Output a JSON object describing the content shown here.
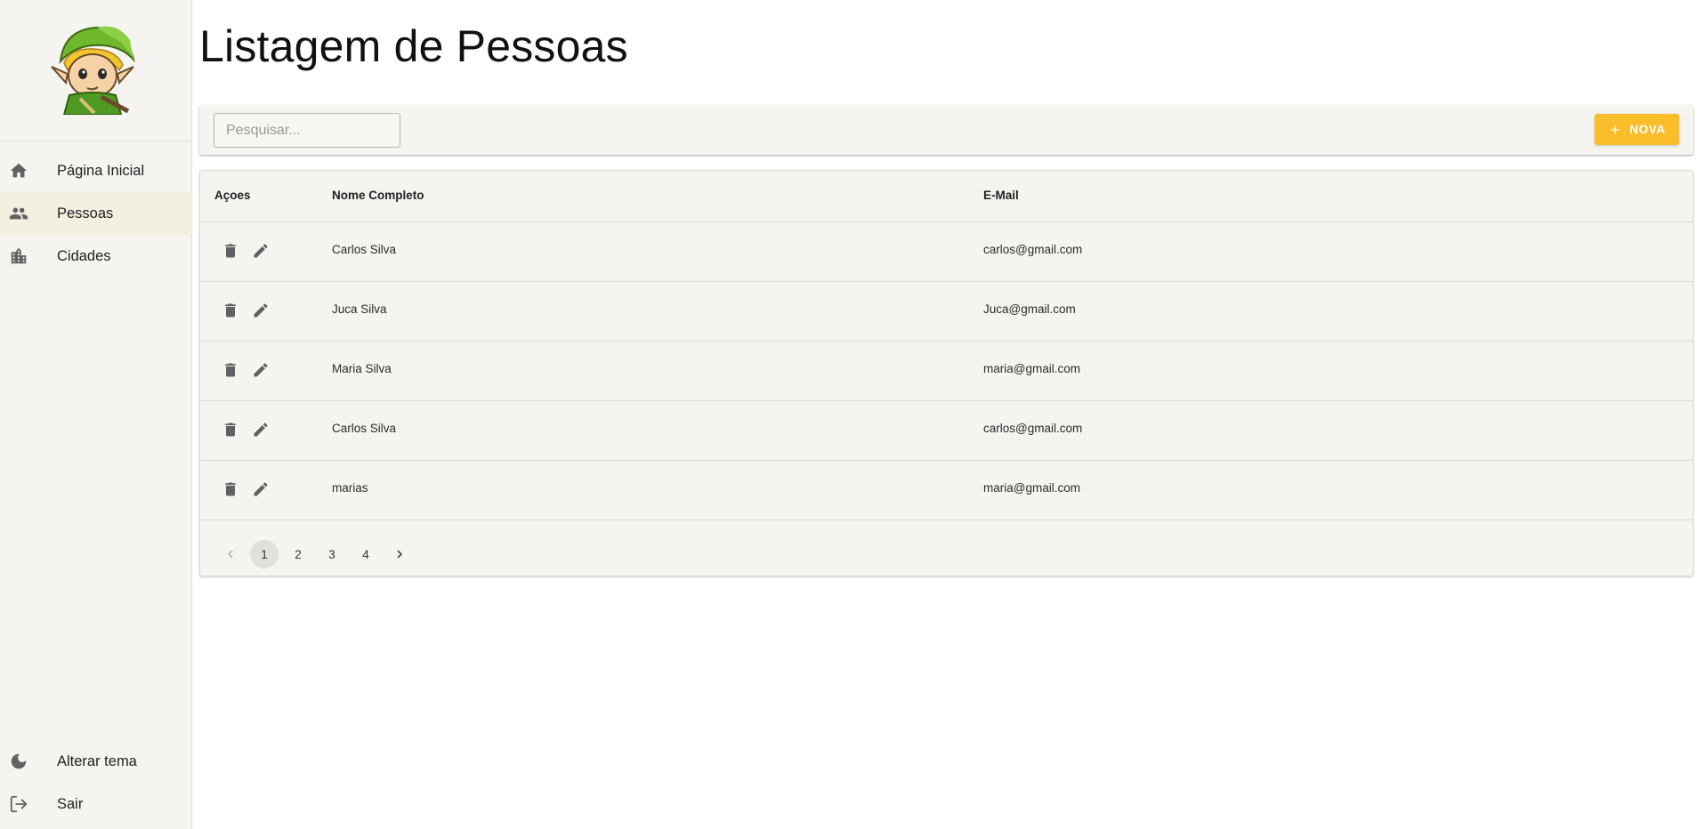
{
  "sidebar": {
    "avatar_alt": "avatar",
    "items": [
      {
        "label": "Página Inicial",
        "icon": "home-icon"
      },
      {
        "label": "Pessoas",
        "icon": "people-icon",
        "active": true
      },
      {
        "label": "Cidades",
        "icon": "city-icon"
      }
    ],
    "bottom": [
      {
        "label": "Alterar tema",
        "icon": "moon-icon"
      },
      {
        "label": "Sair",
        "icon": "logout-icon"
      }
    ]
  },
  "page": {
    "title": "Listagem de Pessoas"
  },
  "toolbar": {
    "search_placeholder": "Pesquisar...",
    "search_value": "",
    "new_label": "NOVA"
  },
  "table": {
    "headers": {
      "actions": "Açoes",
      "name": "Nome Completo",
      "email": "E-Mail"
    },
    "rows": [
      {
        "name": "Carlos Silva",
        "email": "carlos@gmail.com"
      },
      {
        "name": "Juca Silva",
        "email": "Juca@gmail.com"
      },
      {
        "name": "Maria Silva",
        "email": "maria@gmail.com"
      },
      {
        "name": "Carlos Silva",
        "email": "carlos@gmail.com"
      },
      {
        "name": "marias",
        "email": "maria@gmail.com"
      }
    ]
  },
  "pagination": {
    "pages": [
      "1",
      "2",
      "3",
      "4"
    ],
    "current": "1"
  },
  "colors": {
    "accent": "#fbbd2a",
    "surface": "#f5f4f0",
    "active_nav": "#f3efe1",
    "icon": "#616161"
  }
}
